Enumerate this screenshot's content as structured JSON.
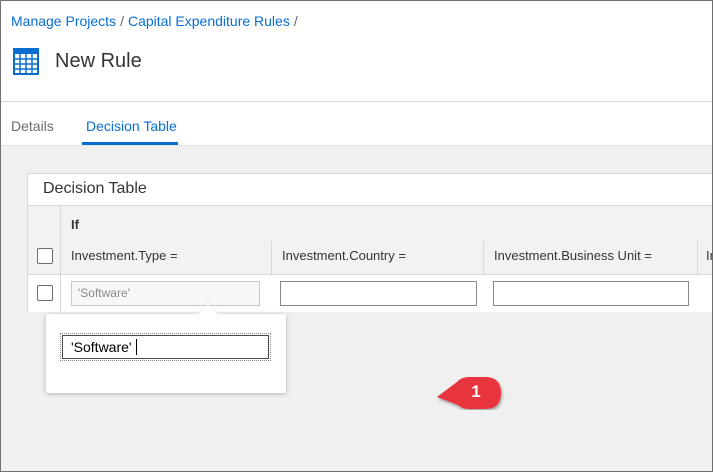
{
  "breadcrumb": {
    "items": [
      "Manage Projects",
      "Capital Expenditure Rules"
    ],
    "separator": "/"
  },
  "page": {
    "title": "New Rule",
    "icon": "table-grid-icon"
  },
  "tabs": [
    {
      "label": "Details",
      "active": false
    },
    {
      "label": "Decision Table",
      "active": true
    }
  ],
  "decision_table": {
    "title": "Decision Table",
    "condition_label": "If",
    "columns": [
      "Investment.Type =",
      "Investment.Country =",
      "Investment.Business Unit =",
      "In"
    ],
    "rows": [
      {
        "values": [
          "'Software'",
          "",
          "",
          ""
        ]
      }
    ]
  },
  "popover": {
    "value": "'Software'"
  },
  "callout": {
    "number": "1",
    "color": "#e8343d"
  },
  "colors": {
    "link": "#0a6ed1",
    "accent": "#0a6ed1",
    "text": "#32363a"
  }
}
